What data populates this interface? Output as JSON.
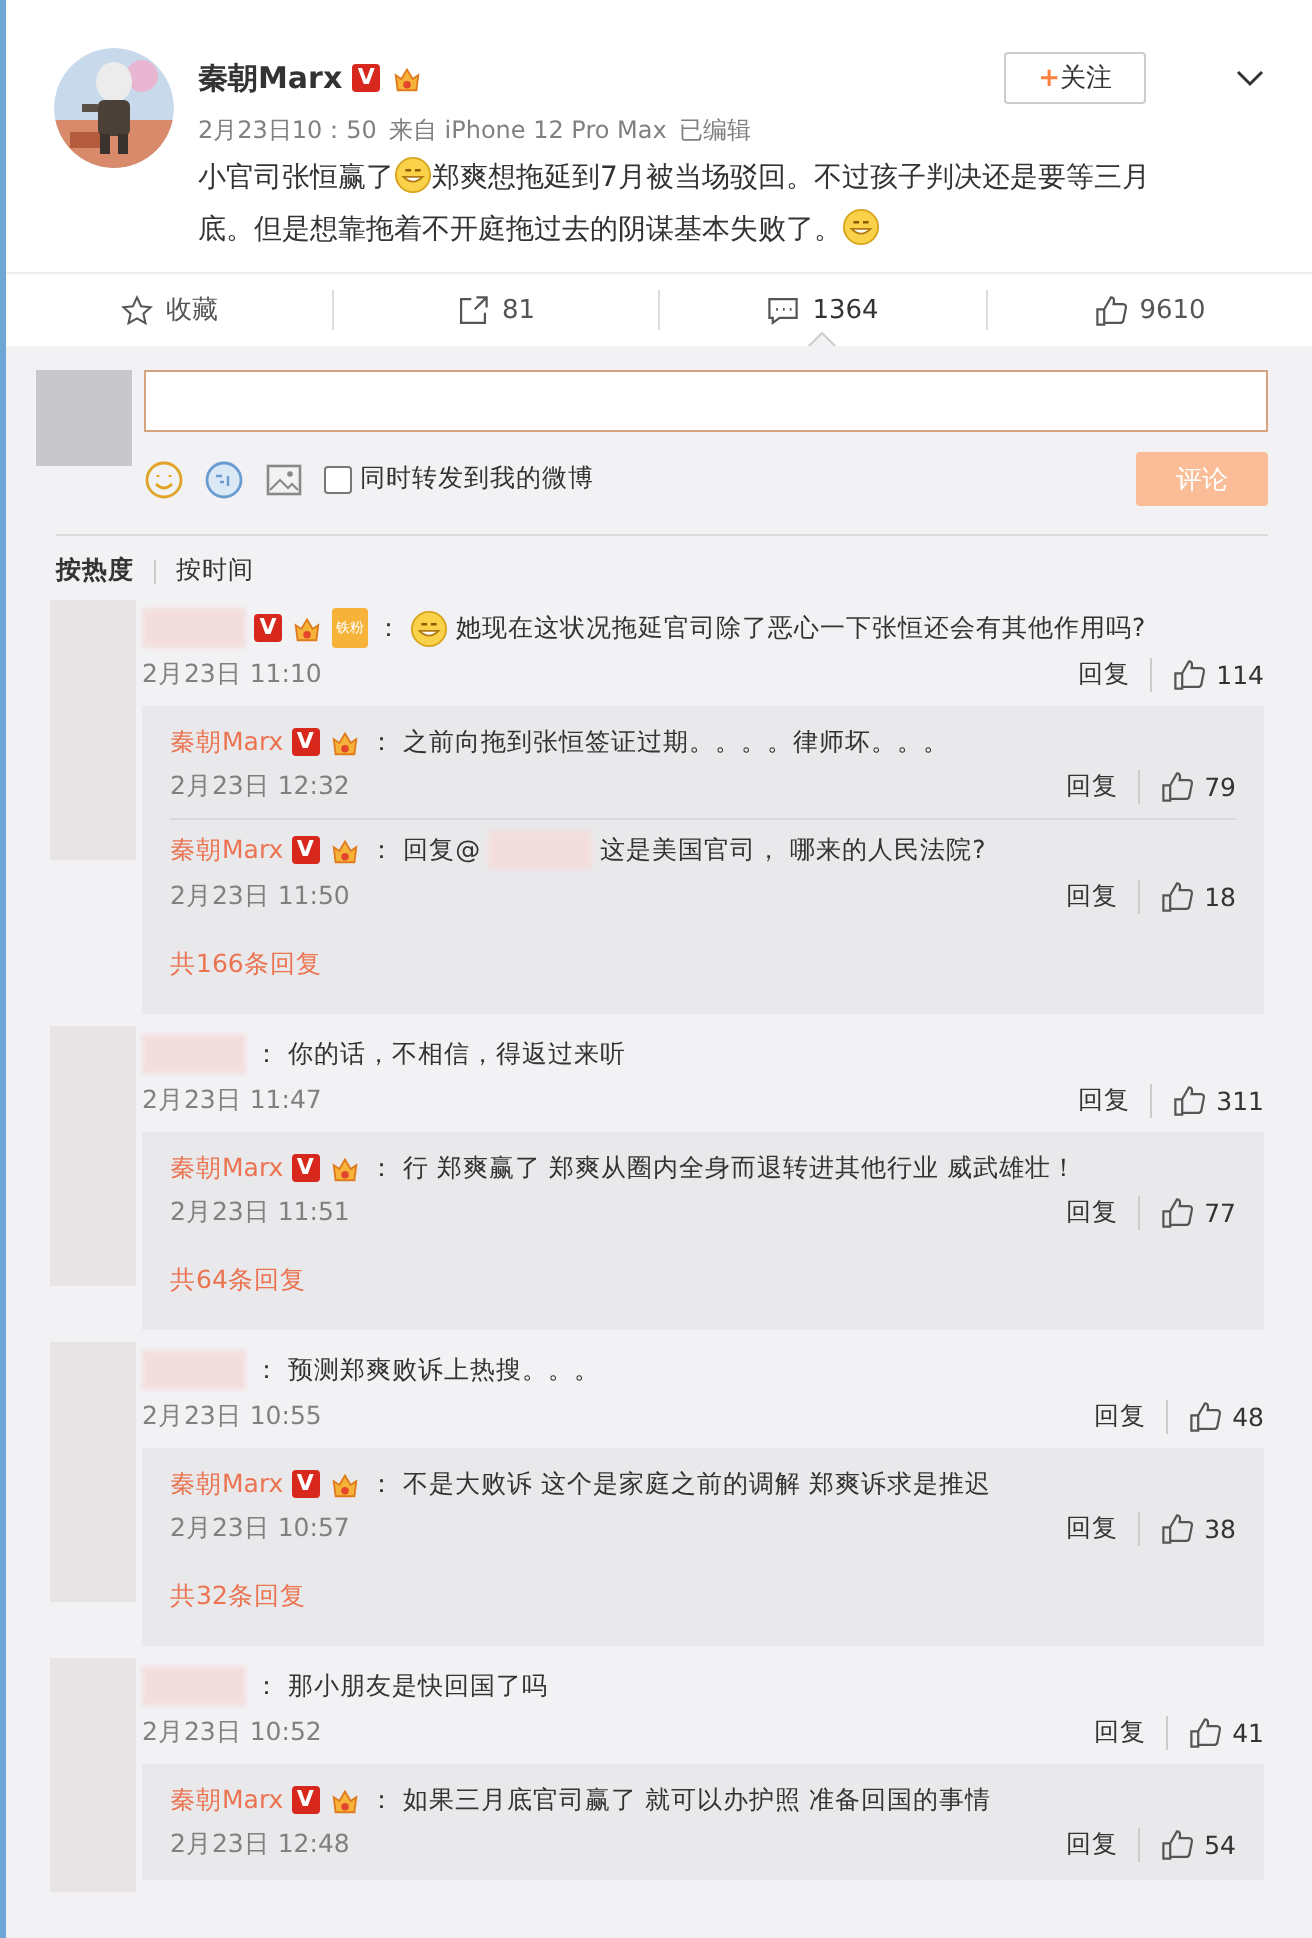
{
  "post": {
    "author": "秦朝Marx",
    "badge": "V",
    "time": "2月23日10：50",
    "source": "来自 iPhone 12 Pro Max",
    "edited": "已编辑",
    "follow_plus": "+",
    "follow": "关注",
    "text": [
      {
        "kind": "text",
        "text": "小官司张恒赢了"
      },
      {
        "kind": "emoji"
      },
      {
        "kind": "text",
        "text": "郑爽想拖延到7月被当场驳回。不过孩子判决还是要等三月"
      },
      {
        "kind": "text",
        "text": "底。但是想靠拖着不开庭拖过去的阴谋基本失败了。"
      },
      {
        "kind": "emoji"
      }
    ]
  },
  "actions": [
    {
      "kind": "favorite",
      "label": "收藏",
      "selected": false
    },
    {
      "kind": "share",
      "label": "81",
      "selected": false
    },
    {
      "kind": "comment",
      "label": "1364",
      "selected": true
    },
    {
      "kind": "like",
      "label": "9610",
      "selected": false
    }
  ],
  "composer": {
    "share_label": "同时转发到我的微博",
    "share_checked": false,
    "submit": "评论"
  },
  "sort_tabs": [
    {
      "label": "按热度",
      "selected": true
    },
    {
      "label": "按时间",
      "selected": false
    }
  ],
  "comments": [
    {
      "badge": "V",
      "fan_label": "铁粉",
      "colon": "：",
      "emoji": true,
      "text": "她现在这状况拖延官司除了恶心一下张恒还会有其他作用吗?",
      "time": "2月23日 11:10",
      "reply": "回复",
      "likes": "114",
      "replies": [
        {
          "author": "秦朝Marx",
          "badge": "V",
          "colon": "：",
          "text": "之前向拖到张恒签证过期。。。。律师坏。。。",
          "time": "2月23日 12:32",
          "reply": "回复",
          "likes": "79"
        },
        {
          "author": "秦朝Marx",
          "badge": "V",
          "colon": "：",
          "mention": "回复@",
          "text": "这是美国官司， 哪来的人民法院?",
          "time": "2月23日 11:50",
          "reply": "回复",
          "likes": "18"
        }
      ],
      "more": "共166条回复"
    },
    {
      "colon": "：",
      "text": "你的话，不相信，得返过来听",
      "time": "2月23日 11:47",
      "reply": "回复",
      "likes": "311",
      "replies": [
        {
          "author": "秦朝Marx",
          "badge": "V",
          "colon": "：",
          "text": "行 郑爽赢了  郑爽从圈内全身而退转进其他行业 威武雄壮！",
          "time": "2月23日 11:51",
          "reply": "回复",
          "likes": "77"
        }
      ],
      "more": "共64条回复"
    },
    {
      "colon": "：",
      "text": "预测郑爽败诉上热搜。。。",
      "time": "2月23日 10:55",
      "reply": "回复",
      "likes": "48",
      "replies": [
        {
          "author": "秦朝Marx",
          "badge": "V",
          "colon": "：",
          "text": "不是大败诉 这个是家庭之前的调解 郑爽诉求是推迟",
          "time": "2月23日 10:57",
          "reply": "回复",
          "likes": "38"
        }
      ],
      "more": "共32条回复"
    },
    {
      "colon": "：",
      "text": "那小朋友是快回国了吗",
      "time": "2月23日 10:52",
      "reply": "回复",
      "likes": "41",
      "replies": [
        {
          "author": "秦朝Marx",
          "badge": "V",
          "colon": "：",
          "text": "如果三月底官司赢了 就可以办护照 准备回国的事情",
          "time": "2月23日 12:48",
          "reply": "回复",
          "likes": "54"
        }
      ]
    }
  ]
}
